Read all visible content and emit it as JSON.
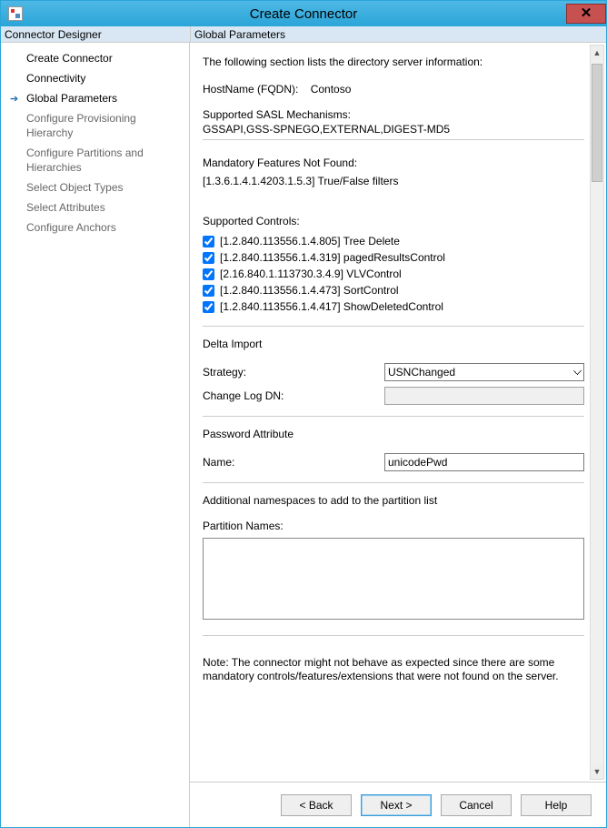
{
  "window": {
    "title": "Create Connector"
  },
  "panels": {
    "left_header": "Connector Designer",
    "right_header": "Global Parameters"
  },
  "nav": {
    "items": [
      {
        "label": "Create Connector",
        "state": "enabled"
      },
      {
        "label": "Connectivity",
        "state": "enabled"
      },
      {
        "label": "Global Parameters",
        "state": "current"
      },
      {
        "label": "Configure Provisioning Hierarchy",
        "state": "disabled"
      },
      {
        "label": "Configure Partitions and Hierarchies",
        "state": "disabled"
      },
      {
        "label": "Select Object Types",
        "state": "disabled"
      },
      {
        "label": "Select Attributes",
        "state": "disabled"
      },
      {
        "label": "Configure Anchors",
        "state": "disabled"
      }
    ]
  },
  "main": {
    "intro": "The following section lists the directory server information:",
    "hostname_label": "HostName (FQDN):",
    "hostname_value": "Contoso",
    "sasl_label": "Supported SASL Mechanisms:",
    "sasl_value": "GSSAPI,GSS-SPNEGO,EXTERNAL,DIGEST-MD5",
    "mandatory_label": "Mandatory Features Not Found:",
    "mandatory_value": "[1.3.6.1.4.1.4203.1.5.3] True/False filters",
    "supported_controls_label": "Supported Controls:",
    "controls": [
      {
        "label": "[1.2.840.113556.1.4.805] Tree Delete",
        "checked": true
      },
      {
        "label": "[1.2.840.113556.1.4.319] pagedResultsControl",
        "checked": true
      },
      {
        "label": "[2.16.840.1.113730.3.4.9] VLVControl",
        "checked": true
      },
      {
        "label": "[1.2.840.113556.1.4.473] SortControl",
        "checked": true
      },
      {
        "label": "[1.2.840.113556.1.4.417] ShowDeletedControl",
        "checked": true
      }
    ],
    "delta_header": "Delta Import",
    "strategy_label": "Strategy:",
    "strategy_value": "USNChanged",
    "changelog_label": "Change Log DN:",
    "changelog_value": "",
    "password_header": "Password Attribute",
    "password_name_label": "Name:",
    "password_name_value": "unicodePwd",
    "namespaces_header": "Additional namespaces to add to the partition list",
    "partition_label": "Partition Names:",
    "partition_value": "",
    "note": "Note: The connector might not behave as expected since there are some mandatory controls/features/extensions that were not found on the server."
  },
  "footer": {
    "back": "<  Back",
    "next": "Next  >",
    "cancel": "Cancel",
    "help": "Help"
  }
}
